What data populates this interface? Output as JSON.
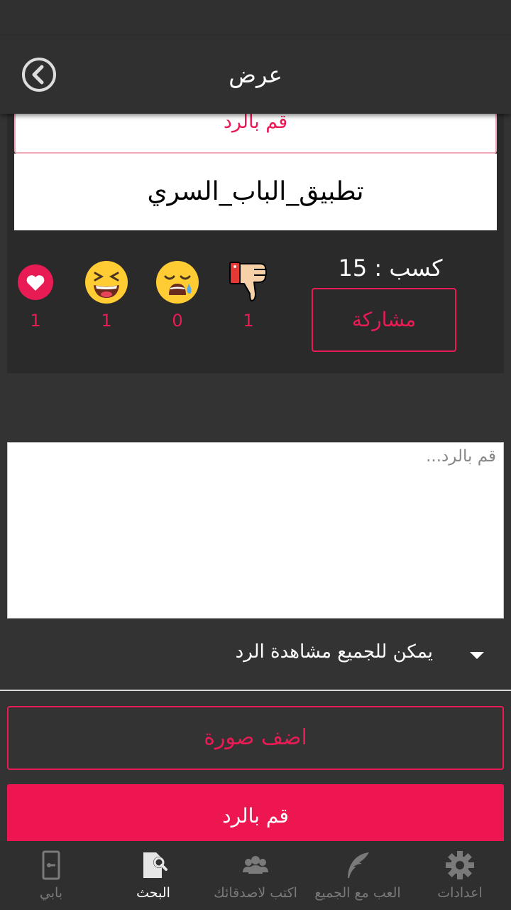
{
  "header": {
    "title": "عرض",
    "back_icon": "chevron-left-circle-icon"
  },
  "post": {
    "reply_button_label": "قم بالرد",
    "content": "تطبيق_الباب_السري",
    "points_text": "كسب : 15",
    "share_label": "مشاركة",
    "reactions": [
      {
        "icon": "thumbs-down-icon",
        "count": "1"
      },
      {
        "icon": "crying-face-icon",
        "count": "0"
      },
      {
        "icon": "laughing-face-icon",
        "count": "1"
      },
      {
        "icon": "heart-icon",
        "count": "1"
      }
    ]
  },
  "reply_form": {
    "placeholder": "قم بالرد...",
    "visibility_option": "يمكن للجميع مشاهدة الرد",
    "add_photo_label": "اضف صورة",
    "submit_label": "قم بالرد"
  },
  "bottom_nav": {
    "items": [
      {
        "label": "اعدادات",
        "icon": "gear-icon"
      },
      {
        "label": "العب مع الجميع",
        "icon": "feather-icon"
      },
      {
        "label": "اكتب لاصدقائك",
        "icon": "friends-icon"
      },
      {
        "label": "البحث",
        "icon": "search-document-icon"
      },
      {
        "label": "بابي",
        "icon": "door-icon"
      }
    ],
    "active": "البحث"
  },
  "colors": {
    "accent": "#e91b55",
    "background": "#333333",
    "bar": "#303030"
  }
}
